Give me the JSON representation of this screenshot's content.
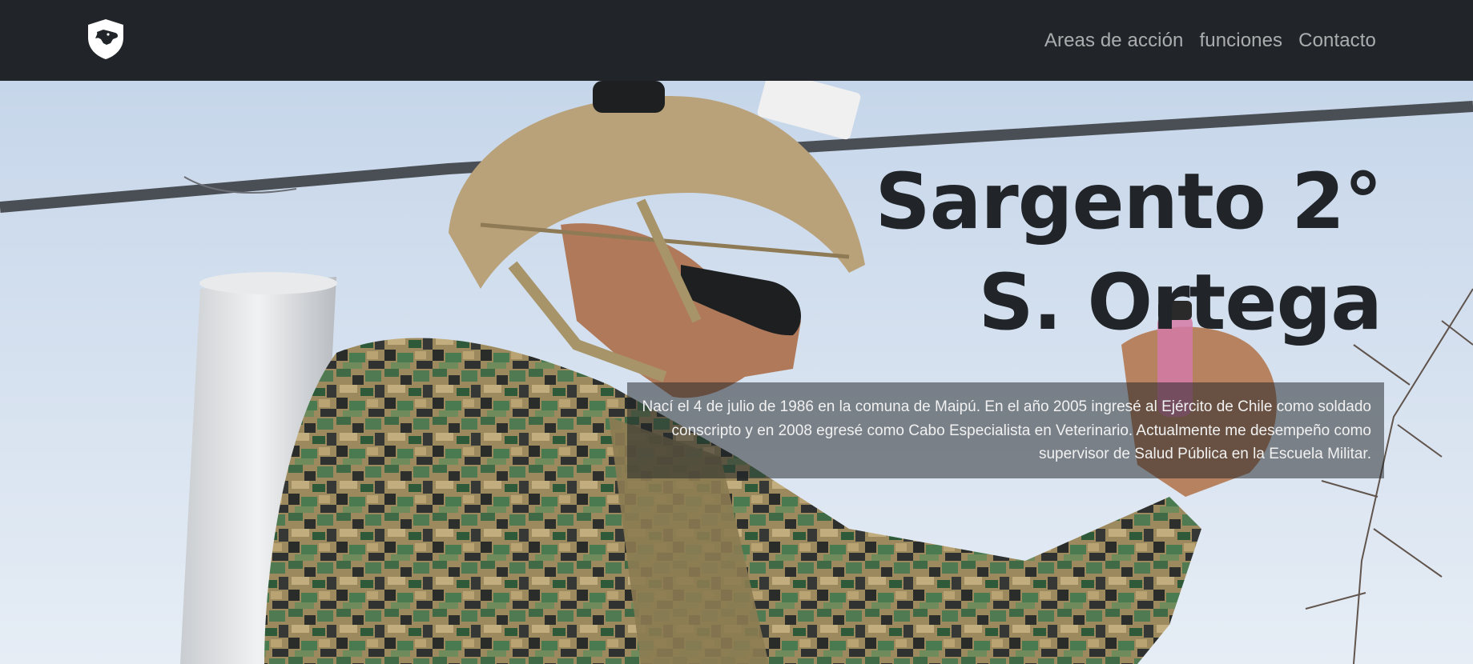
{
  "nav": {
    "logo_icon": "shield-dog-icon",
    "links": [
      {
        "label": "Areas de acción"
      },
      {
        "label": "funciones"
      },
      {
        "label": "Contacto"
      }
    ]
  },
  "hero": {
    "title_line1": "Sargento 2°",
    "title_line2": "S. Ortega",
    "bio": "Nací el 4 de julio de 1986 en la comuna de Maipú. En el año 2005 ingresé al Ejército de Chile como soldado conscripto y en 2008 egresé como Cabo Especialista en Veterinario. Actualmente me desempeño como supervisor de Salud Pública en la Escuela Militar."
  },
  "colors": {
    "navbar_bg": "#212529",
    "title_color": "#212529",
    "nav_link_color": "rgba(255,255,255,0.62)"
  }
}
